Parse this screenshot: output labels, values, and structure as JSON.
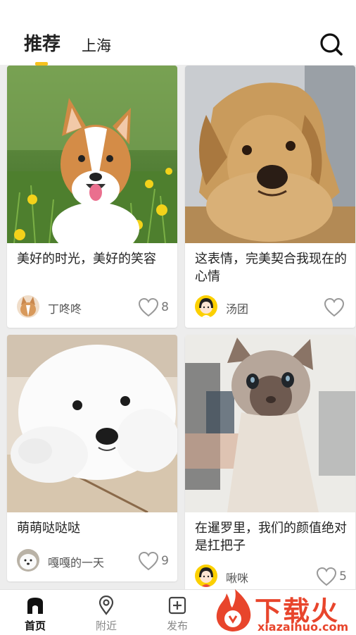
{
  "header": {
    "tabs": [
      {
        "label": "推荐",
        "active": true
      },
      {
        "label": "上海",
        "active": false
      }
    ],
    "search_icon": "search-icon",
    "accent_color": "#f7c21e"
  },
  "posts": [
    {
      "title": "美好的时光，美好的笑容",
      "author": "丁咚咚",
      "likes": "8",
      "photo": "corgi"
    },
    {
      "title": "这表情，完美契合我现在的心情",
      "author": "汤团",
      "likes": "",
      "photo": "golden-retriever"
    },
    {
      "title": "萌萌哒哒哒",
      "author": "嘎嘎的一天",
      "likes": "9",
      "photo": "samoyed-puppy"
    },
    {
      "title": "在暹罗里，我们的颜值绝对是扛把子",
      "author": "啾咪",
      "likes": "5",
      "photo": "siamese-cat"
    }
  ],
  "nav": {
    "items": [
      {
        "label": "首页",
        "icon": "home-icon",
        "active": true
      },
      {
        "label": "附近",
        "icon": "location-pin-icon",
        "active": false
      },
      {
        "label": "发布",
        "icon": "add-square-icon",
        "active": false
      }
    ]
  },
  "watermark": {
    "title": "下载火",
    "url": "xiazaihuo.com"
  }
}
